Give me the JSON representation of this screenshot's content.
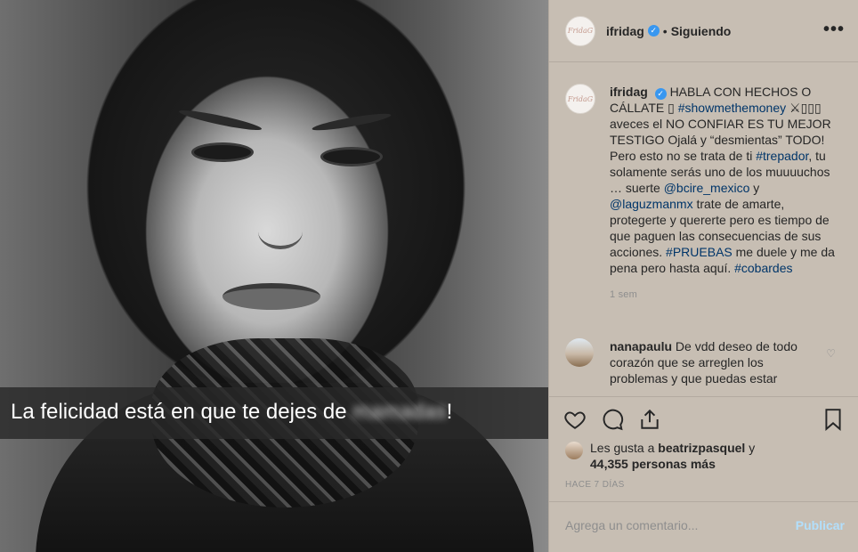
{
  "photo": {
    "caption_visible": "La felicidad está en que te dejes de",
    "caption_blurred": "mamadas",
    "caption_end": "!"
  },
  "header": {
    "username": "ifridag",
    "separator": "•",
    "follow_status": "Siguiendo",
    "more_icon": "ellipsis-icon",
    "avatar_text": "FridaG"
  },
  "post_caption": {
    "username": "ifridag",
    "text_1": "HABLA CON HECHOS O CÁLLATE ",
    "emoji_1": "▯",
    "hashtag_1": "#showmethemoney",
    "emoji_2": " ⚔▯▯▯",
    "text_2": " aveces el NO CONFIAR ES TU MEJOR TESTIGO Ojalá y “desmientas” TODO! Pero esto no se trata de ti ",
    "hashtag_2": "#trepador",
    "text_3": ", tu solamente serás uno de los muuuuchos … suerte ",
    "mention_1": "@bcire_mexico",
    "text_4": " y ",
    "mention_2": "@laguzmanmx",
    "text_5": " trate de amarte, protegerte y quererte pero es tiempo de que paguen las consecuencias de sus acciones. ",
    "hashtag_3": "#PRUEBAS",
    "text_6": " me duele y me da pena pero hasta aquí. ",
    "hashtag_4": "#cobardes",
    "time": "1 sem"
  },
  "comment": {
    "username": "nanapaulu",
    "text": "De vdd deseo de todo corazón que se arreglen los problemas y que puedas estar"
  },
  "actions": {
    "likes_prefix": "Les gusta a",
    "likes_user": "beatrizpasquel",
    "likes_and": "y",
    "likes_count": "44,355 personas más",
    "posted_ago": "HACE 7 DÍAS"
  },
  "add_comment": {
    "placeholder": "Agrega un comentario...",
    "publish_label": "Publicar"
  },
  "colors": {
    "panel_bg": "#c7beb3",
    "link": "#003569",
    "verified": "#3897f0",
    "publish_disabled": "#b2dffc"
  }
}
